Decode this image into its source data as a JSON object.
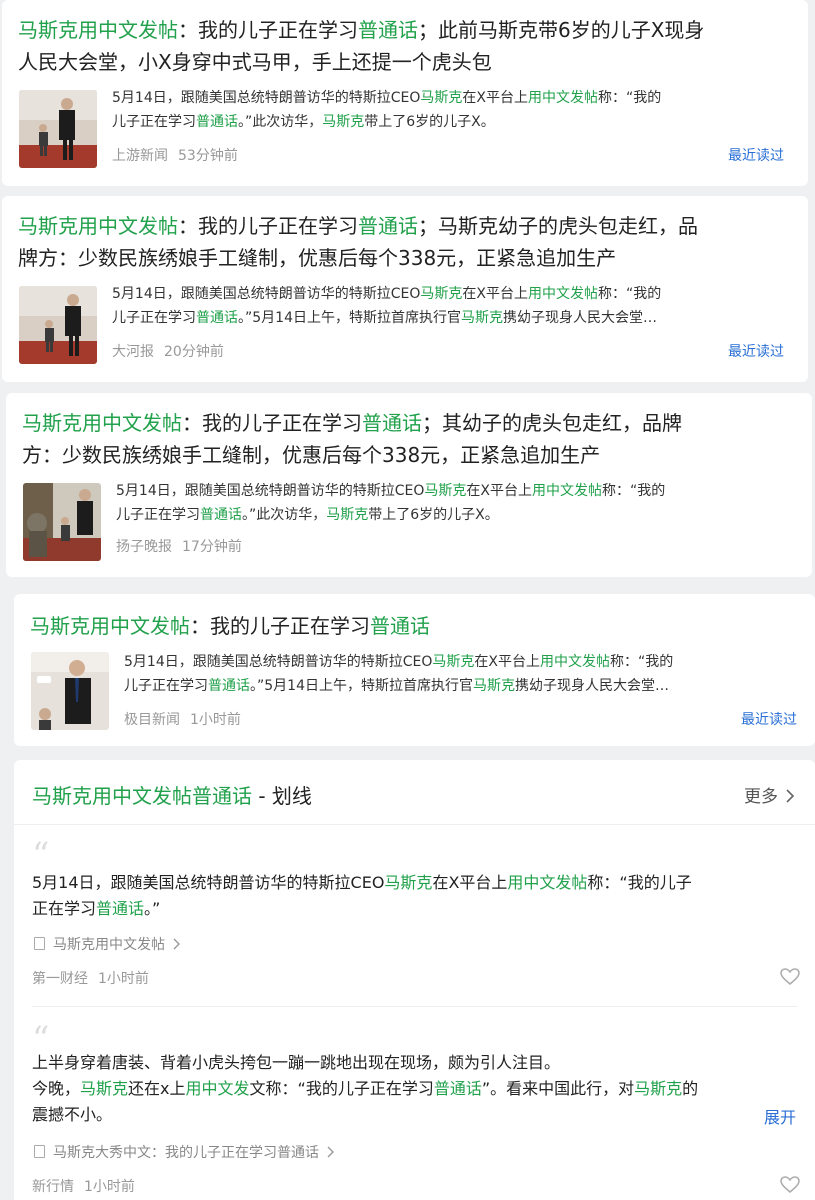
{
  "articles": [
    {
      "title_hl": "马斯克用中文发帖",
      "title_line1_rest": "：我的儿子正在学习",
      "title_hl2": "普通话",
      "title_line1_tail": "；此前马斯克带6岁的儿子X现身",
      "title_line2": "人民大会堂，小X身穿中式马甲，手上还提一个虎头包",
      "snippet_line1_a": "5月14日，跟随美国总统特朗普访华的特斯拉CEO",
      "snippet_line1_hl": "马斯克",
      "snippet_line1_b": "在X平台上",
      "snippet_line1_hl2": "用中文发帖",
      "snippet_line1_c": "称：“我的",
      "snippet_line2_a": "儿子正在学习",
      "snippet_line2_hl": "普通话",
      "snippet_line2_b": "。”此次访华，",
      "snippet_line2_hl2": "马斯克",
      "snippet_line2_c": "带上了6岁的儿子X。",
      "source": "上游新闻",
      "time": "53分钟前",
      "recent": "最近读过"
    },
    {
      "title_hl": "马斯克用中文发帖",
      "title_line1_rest": "：我的儿子正在学习",
      "title_hl2": "普通话",
      "title_line1_tail": "；马斯克幼子的虎头包走红，品",
      "title_line2": "牌方：少数民族绣娘手工缝制，优惠后每个338元，正紧急追加生产",
      "snippet_line1_a": "5月14日，跟随美国总统特朗普访华的特斯拉CEO",
      "snippet_line1_hl": "马斯克",
      "snippet_line1_b": "在X平台上",
      "snippet_line1_hl2": "用中文发帖",
      "snippet_line1_c": "称：“我的",
      "snippet_line2_a": "儿子正在学习",
      "snippet_line2_hl": "普通话",
      "snippet_line2_b": "。”5月14日上午，特斯拉首席执行官",
      "snippet_line2_hl2": "马斯克",
      "snippet_line2_c": "携幼子现身人民大会堂…",
      "source": "大河报",
      "time": "20分钟前",
      "recent": "最近读过"
    },
    {
      "title_hl": "马斯克用中文发帖",
      "title_line1_rest": "：我的儿子正在学习",
      "title_hl2": "普通话",
      "title_line1_tail": "；其幼子的虎头包走红，品牌",
      "title_line2": "方：少数民族绣娘手工缝制，优惠后每个338元，正紧急追加生产",
      "snippet_line1_a": "5月14日，跟随美国总统特朗普访华的特斯拉CEO",
      "snippet_line1_hl": "马斯克",
      "snippet_line1_b": "在X平台上",
      "snippet_line1_hl2": "用中文发帖",
      "snippet_line1_c": "称：“我的",
      "snippet_line2_a": "儿子正在学习",
      "snippet_line2_hl": "普通话",
      "snippet_line2_b": "。”此次访华，",
      "snippet_line2_hl2": "马斯克",
      "snippet_line2_c": "带上了6岁的儿子X。",
      "source": "扬子晚报",
      "time": "17分钟前",
      "recent": ""
    },
    {
      "title_hl": "马斯克用中文发帖",
      "title_line1_rest": "：我的儿子正在学习",
      "title_hl2": "普通话",
      "title_line1_tail": "",
      "title_line2": "",
      "snippet_line1_a": "5月14日，跟随美国总统特朗普访华的特斯拉CEO",
      "snippet_line1_hl": "马斯克",
      "snippet_line1_b": "在X平台上",
      "snippet_line1_hl2": "用中文发帖",
      "snippet_line1_c": "称：“我的",
      "snippet_line2_a": "儿子正在学习",
      "snippet_line2_hl": "普通话",
      "snippet_line2_b": "。”5月14日上午，特斯拉首席执行官",
      "snippet_line2_hl2": "马斯克",
      "snippet_line2_c": "携幼子现身人民大会堂…",
      "source": "极目新闻",
      "time": "1小时前",
      "recent": "最近读过"
    }
  ],
  "highlights": {
    "title_hl": "马斯克用中文发帖普通话",
    "title_rest": " - 划线",
    "more": "更多",
    "items": [
      {
        "line1_a": "5月14日，跟随美国总统特朗普访华的特斯拉CEO",
        "line1_hl": "马斯克",
        "line1_b": "在X平台上",
        "line1_hl2": "用中文发帖",
        "line1_c": "称：“我的儿子",
        "line2_a": "正在学习",
        "line2_hl": "普通话",
        "line2_b": "。”",
        "link": "马斯克用中文发帖",
        "source": "第一财经",
        "time": "1小时前"
      },
      {
        "line1": "上半身穿着唐装、背着小虎头挎包一蹦一跳地出现在现场，颇为引人注目。",
        "line2_a": "今晚，",
        "line2_hl": "马斯克",
        "line2_b": "还在x上",
        "line2_hl2": "用中文发",
        "line2_c": "文称：“我的儿子正在学习",
        "line2_hl3": "普通话",
        "line2_d": "”。看来中国此行，对",
        "line2_hl4": "马斯克",
        "line2_e": "的",
        "line3": "震撼不小。",
        "expand": "展开",
        "link": "马斯克大秀中文：我的儿子正在学习普通话",
        "source": "新行情",
        "time": "1小时前"
      }
    ]
  }
}
